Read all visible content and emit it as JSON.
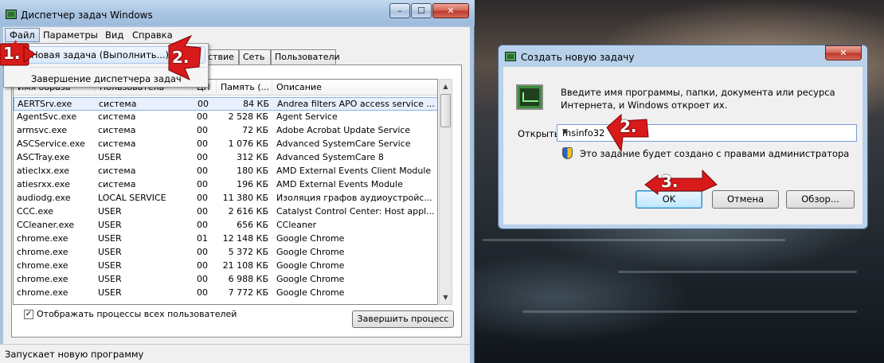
{
  "task_manager": {
    "title": "Диспетчер задач Windows",
    "caption": {
      "minimize": "–",
      "maximize": "☐",
      "close": "✕"
    },
    "menu": {
      "file": "Файл",
      "options": "Параметры",
      "view": "Вид",
      "help": "Справка"
    },
    "tabs_visible": [
      "ствие",
      "Сеть",
      "Пользователи"
    ],
    "file_menu": {
      "new_task": "Новая задача (Выполнить...)",
      "exit": "Завершение диспетчера задач"
    },
    "columns": {
      "image": "Имя образа",
      "user": "Пользователь",
      "cpu": "ЦП",
      "memory": "Память (...",
      "description": "Описание"
    },
    "processes": [
      {
        "image": "AERTSrv.exe",
        "user": "система",
        "cpu": "00",
        "memory": "84 КБ",
        "description": "Andrea filters APO access service ..."
      },
      {
        "image": "AgentSvc.exe",
        "user": "система",
        "cpu": "00",
        "memory": "2 528 КБ",
        "description": "Agent Service"
      },
      {
        "image": "armsvc.exe",
        "user": "система",
        "cpu": "00",
        "memory": "72 КБ",
        "description": "Adobe Acrobat Update Service"
      },
      {
        "image": "ASCService.exe",
        "user": "система",
        "cpu": "00",
        "memory": "1 076 КБ",
        "description": "Advanced SystemCare Service"
      },
      {
        "image": "ASCTray.exe",
        "user": "USER",
        "cpu": "00",
        "memory": "312 КБ",
        "description": "Advanced SystemCare 8"
      },
      {
        "image": "atieclxx.exe",
        "user": "система",
        "cpu": "00",
        "memory": "180 КБ",
        "description": "AMD External Events Client Module"
      },
      {
        "image": "atiesrxx.exe",
        "user": "система",
        "cpu": "00",
        "memory": "196 КБ",
        "description": "AMD External Events Module"
      },
      {
        "image": "audiodg.exe",
        "user": "LOCAL SERVICE",
        "cpu": "00",
        "memory": "11 380 КБ",
        "description": "Изоляция графов аудиоустройс..."
      },
      {
        "image": "CCC.exe",
        "user": "USER",
        "cpu": "00",
        "memory": "2 616 КБ",
        "description": "Catalyst Control Center: Host appl..."
      },
      {
        "image": "CCleaner.exe",
        "user": "USER",
        "cpu": "00",
        "memory": "656 КБ",
        "description": "CCleaner"
      },
      {
        "image": "chrome.exe",
        "user": "USER",
        "cpu": "01",
        "memory": "12 148 КБ",
        "description": "Google Chrome"
      },
      {
        "image": "chrome.exe",
        "user": "USER",
        "cpu": "00",
        "memory": "5 372 КБ",
        "description": "Google Chrome"
      },
      {
        "image": "chrome.exe",
        "user": "USER",
        "cpu": "00",
        "memory": "21 108 КБ",
        "description": "Google Chrome"
      },
      {
        "image": "chrome.exe",
        "user": "USER",
        "cpu": "00",
        "memory": "6 988 КБ",
        "description": "Google Chrome"
      },
      {
        "image": "chrome.exe",
        "user": "USER",
        "cpu": "00",
        "memory": "7 772 КБ",
        "description": "Google Chrome"
      }
    ],
    "show_all_users": "Отображать процессы всех пользователей",
    "show_all_checked": "✓",
    "end_process": "Завершить процесс",
    "status": "Запускает новую программу"
  },
  "dialog": {
    "title": "Создать новую задачу",
    "close": "✕",
    "description": "Введите имя программы, папки, документа или ресурса Интернета, и Windows откроет их.",
    "open_label": "Открыть:",
    "open_value": "msinfo32",
    "admin_note": "Это задание будет создано с правами администратора",
    "ok": "OK",
    "cancel": "Отмена",
    "browse": "Обзор..."
  },
  "annotations": {
    "step1": "1.",
    "step2a": "2.",
    "step2b": "2.",
    "step3": "3."
  },
  "colors": {
    "annotation_red": "#d91a1a",
    "selection": "#e7f0fc",
    "title_blue": "#aac5e3"
  }
}
